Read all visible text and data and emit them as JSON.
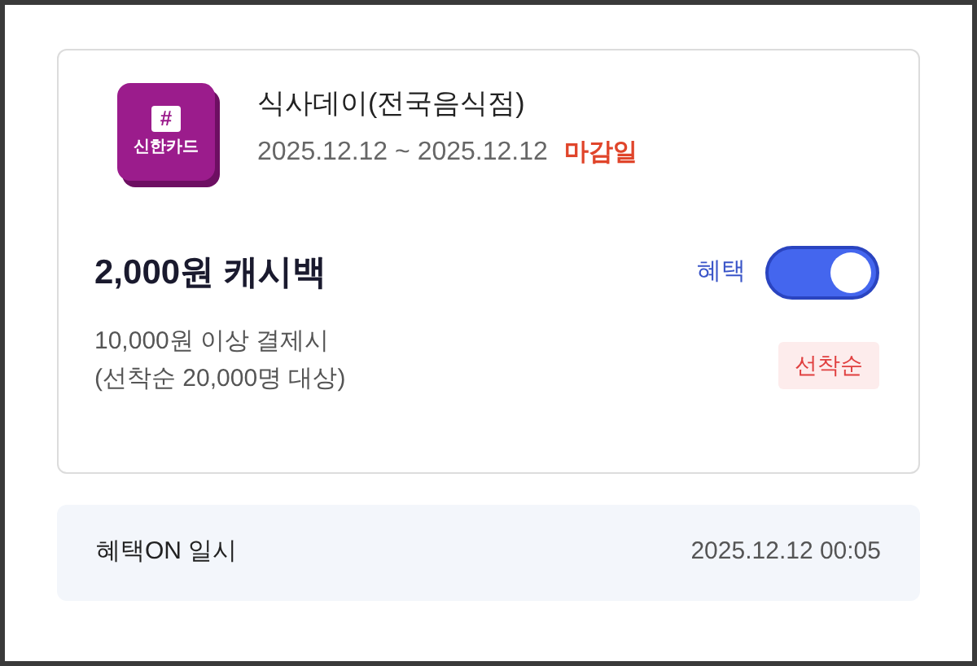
{
  "benefit_card": {
    "logo": {
      "symbol": "#",
      "text": "신한카드"
    },
    "title": "식사데이(전국음식점)",
    "period": "2025.12.12 ~ 2025.12.12",
    "deadline_badge": "마감일",
    "amount": "2,000원 캐시백",
    "toggle": {
      "label": "혜택",
      "on": true
    },
    "conditions": [
      "10,000원 이상 결제시",
      "(선착순 20,000명 대상)"
    ],
    "tag": "선착순"
  },
  "activation": {
    "label": "혜택ON 일시",
    "value": "2025.12.12 00:05"
  }
}
